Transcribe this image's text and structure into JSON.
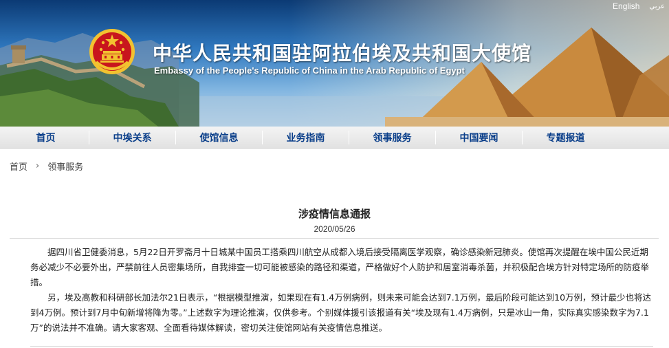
{
  "header": {
    "lang_arabic": "عربي",
    "lang_english": "English",
    "title_cn": "中华人民共和国驻阿拉伯埃及共和国大使馆",
    "title_en": "Embassy of the People's Republic of China in the Arab Republic of Egypt"
  },
  "nav": {
    "items": [
      {
        "label": "首页"
      },
      {
        "label": "中埃关系"
      },
      {
        "label": "使馆信息"
      },
      {
        "label": "业务指南"
      },
      {
        "label": "领事服务"
      },
      {
        "label": "中国要闻"
      },
      {
        "label": "专题报道"
      }
    ]
  },
  "breadcrumb": {
    "home": "首页",
    "separator": "›",
    "current": "领事服务"
  },
  "article": {
    "title": "涉疫情信息通报",
    "date": "2020/05/26",
    "paragraphs": [
      "据四川省卫健委消息，5月22日开罗斋月十日城某中国员工搭乘四川航空从成都入境后接受隔离医学观察，确诊感染新冠肺炎。使馆再次提醒在埃中国公民近期务必减少不必要外出，严禁前往人员密集场所，自我排查一切可能被感染的路径和渠道，严格做好个人防护和居室消毒杀菌，并积极配合埃方针对特定场所的防疫举措。",
      "另，埃及高教和科研部长加法尔21日表示，“根据模型推演，如果现在有1.4万例病例，则未来可能会达到7.1万例，最后阶段可能达到10万例，预计最少也将达到4万例。预计到7月中旬新增将降为零。”上述数字为理论推演，仅供参考。个别媒体援引该报道有关“埃及现有1.4万病例，只是冰山一角，实际真实感染数字为7.1万”的说法并不准确。请大家客观、全面看待媒体解读，密切关注使馆网站有关疫情信息推送。"
    ]
  },
  "colors": {
    "nav_text": "#0b3f8a",
    "banner_sky": "#2f78bf",
    "emblem_red": "#c8161d",
    "emblem_gold": "#f2c230"
  }
}
